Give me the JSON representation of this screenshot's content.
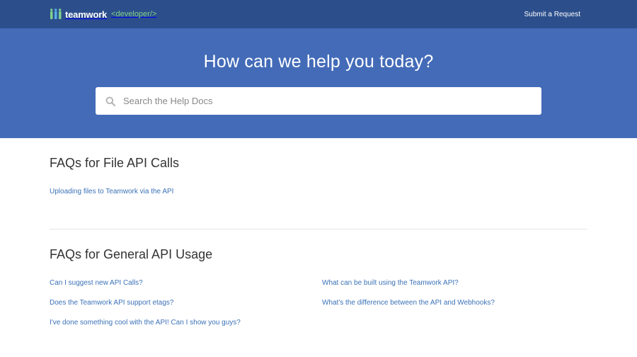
{
  "header": {
    "brand_name": "teamwork",
    "brand_tag": "<developer/>",
    "submit_label": "Submit a Request"
  },
  "hero": {
    "title": "How can we help you today?",
    "search_placeholder": "Search the Help Docs"
  },
  "sections": [
    {
      "title": "FAQs for File API Calls",
      "links": [
        "Uploading files to Teamwork via the API"
      ]
    },
    {
      "title": "FAQs for General API Usage",
      "links": [
        "Can I suggest new API Calls?",
        "What can be built using the Teamwork API?",
        "Does the Teamwork API support etags?",
        "What's the difference between the API and Webhooks?",
        "I've done something cool with the API! Can I show you guys?"
      ]
    }
  ],
  "colors": {
    "topbar": "#2c4f8c",
    "hero": "#436bb8",
    "link": "#3b72b7",
    "brand_tag": "#7fd18a"
  }
}
